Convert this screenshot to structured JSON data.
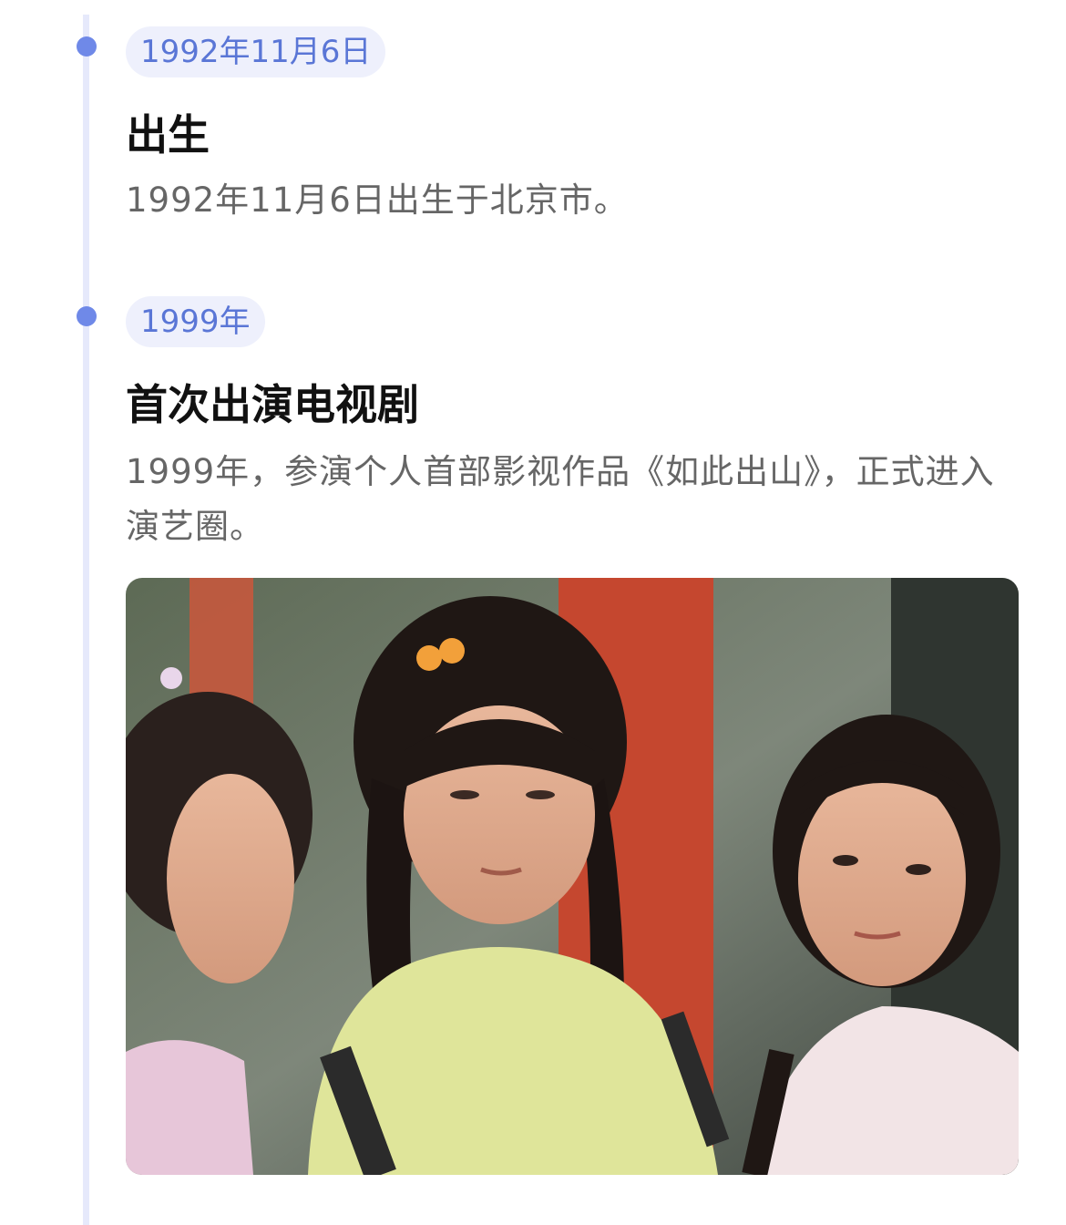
{
  "entries": [
    {
      "date": "1992年11月6日",
      "title": "出生",
      "description": "1992年11月6日出生于北京市。"
    },
    {
      "date": "1999年",
      "title": "首次出演电视剧",
      "description": "1999年，参演个人首部影视作品《如此出山》，正式进入演艺圈。"
    }
  ],
  "photo": {
    "icon": "photo-still-image"
  },
  "colors": {
    "accent": "#6f89e8",
    "pill_bg": "#eef0fc",
    "pill_text": "#5a76d6",
    "line": "#e6e9fb",
    "title": "#111111",
    "desc": "#666666"
  }
}
